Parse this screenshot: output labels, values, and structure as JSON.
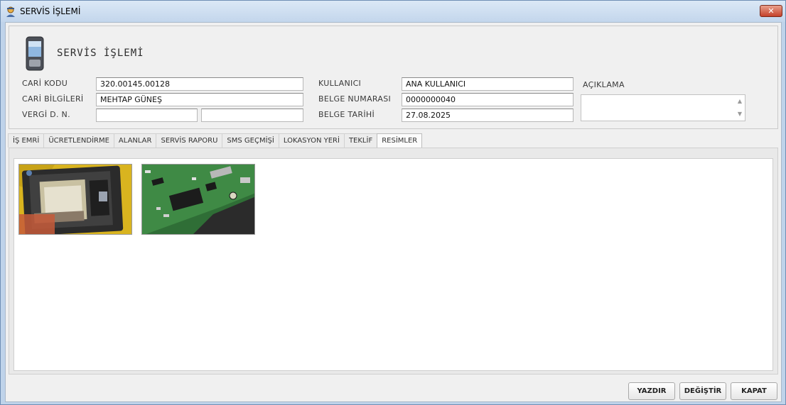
{
  "window": {
    "title": "SERVİS İŞLEMİ",
    "close_label": "✕"
  },
  "header": {
    "title": "SERVİS İŞLEMİ",
    "cari_kodu": {
      "label": "CARİ KODU",
      "value": "320.00145.00128"
    },
    "cari_bilgileri": {
      "label": "CARİ BİLGİLERİ",
      "value": "MEHTAP GÜNEŞ"
    },
    "vergi": {
      "label": "VERGİ D. N.",
      "value1": "",
      "value2": ""
    },
    "kullanici": {
      "label": "KULLANICI",
      "value": "ANA KULLANICI"
    },
    "belge_numarasi": {
      "label": "BELGE NUMARASI",
      "value": "0000000040"
    },
    "belge_tarihi": {
      "label": "BELGE TARİHİ",
      "value": "27.08.2025"
    },
    "aciklama": {
      "label": "AÇIKLAMA",
      "value": ""
    }
  },
  "tabs": [
    {
      "label": "İŞ EMRİ",
      "active": false
    },
    {
      "label": "ÜCRETLENDİRME",
      "active": false
    },
    {
      "label": "ALANLAR",
      "active": false
    },
    {
      "label": "SERVİS RAPORU",
      "active": false
    },
    {
      "label": "SMS GEÇMİŞİ",
      "active": false
    },
    {
      "label": "LOKASYON YERİ",
      "active": false
    },
    {
      "label": "TEKLİF",
      "active": false
    },
    {
      "label": "RESİMLER",
      "active": true
    }
  ],
  "images": [
    {
      "name": "phone-battery-photo"
    },
    {
      "name": "circuit-board-photo"
    }
  ],
  "buttons": {
    "print": "YAZDIR",
    "change": "DEĞİŞTİR",
    "close": "KAPAT"
  },
  "colors": {
    "title_bar": "#c3d6ec",
    "close_red": "#c4412a",
    "form_bg": "#f0f0f0"
  }
}
